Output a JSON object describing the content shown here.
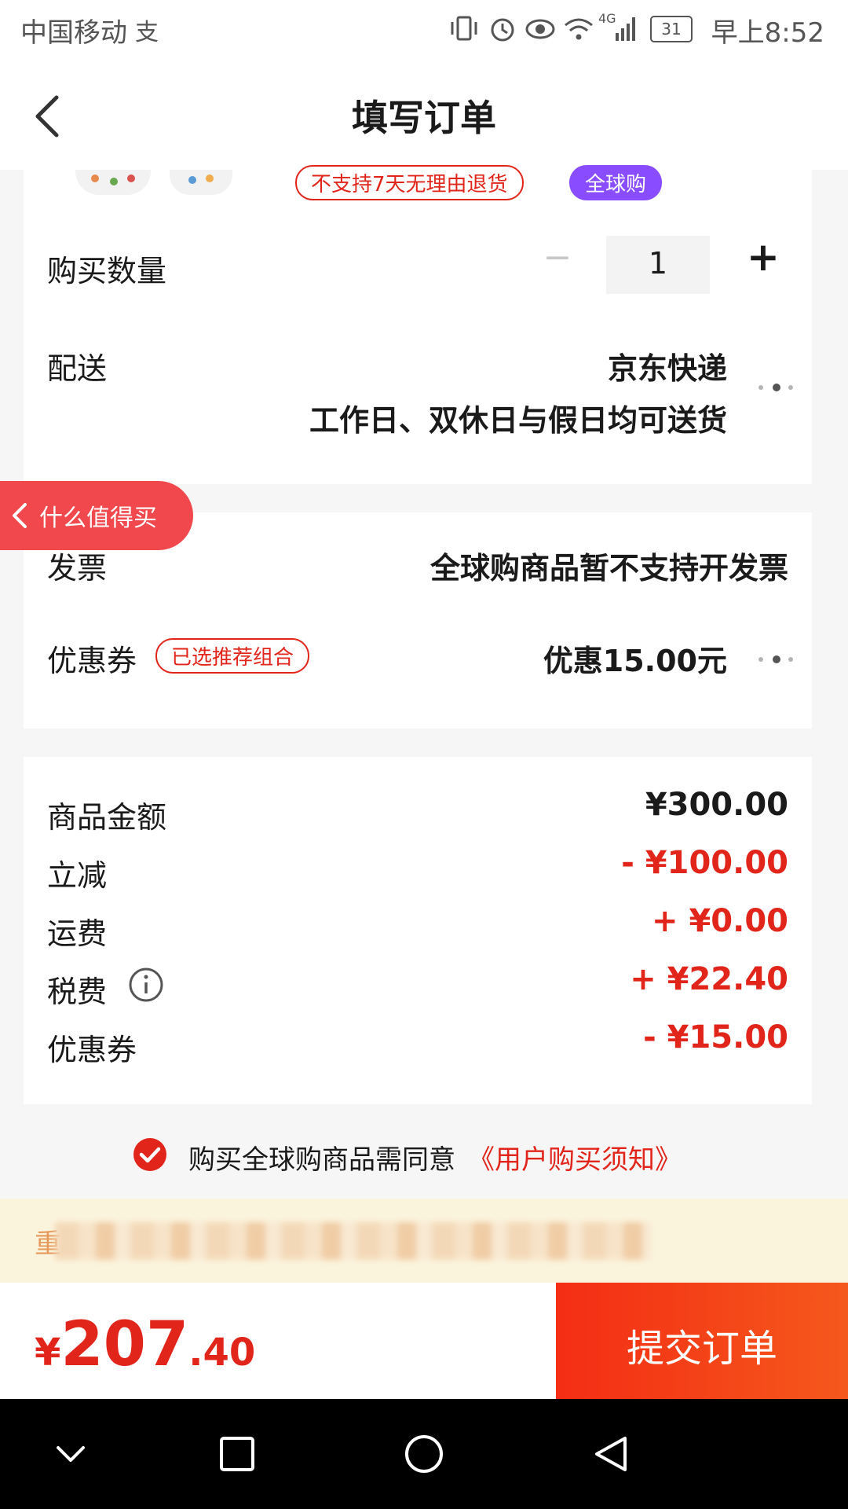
{
  "status_bar": {
    "carrier": "中国移动",
    "network": "4G",
    "battery": "31",
    "time": "早上8:52"
  },
  "header": {
    "title": "填写订单"
  },
  "product": {
    "tags": [
      "不支持7天无理由退货",
      "全球购"
    ]
  },
  "quantity": {
    "label": "购买数量",
    "value": "1",
    "minus": "−",
    "plus": "+"
  },
  "delivery": {
    "label": "配送",
    "carrier": "京东快递",
    "schedule": "工作日、双休日与假日均可送货"
  },
  "float_tab": {
    "label": "什么值得买"
  },
  "invoice": {
    "label": "发票",
    "value": "全球购商品暂不支持开发票"
  },
  "coupon": {
    "label": "优惠券",
    "badge": "已选推荐组合",
    "value": "优惠15.00元"
  },
  "price_breakdown": {
    "items": [
      {
        "label": "商品金额",
        "value": "¥300.00"
      },
      {
        "label": "立减",
        "value": "- ¥100.00"
      },
      {
        "label": "运费",
        "value": "+ ¥0.00"
      },
      {
        "label": "税费",
        "value": "+ ¥22.40"
      },
      {
        "label": "优惠券",
        "value": "- ¥15.00"
      }
    ]
  },
  "agreement": {
    "text": "购买全球购商品需同意",
    "link": "《用户购买须知》"
  },
  "notice": {
    "text": "重"
  },
  "total": {
    "currency": "¥",
    "integer": "207",
    "decimal": ".40"
  },
  "submit_label": "提交订单",
  "colors": {
    "brand_red": "#e1251b",
    "purple_tag": "#8a4cff",
    "float_tab": "#f0484d",
    "notice_bg": "#fbf4dd"
  }
}
